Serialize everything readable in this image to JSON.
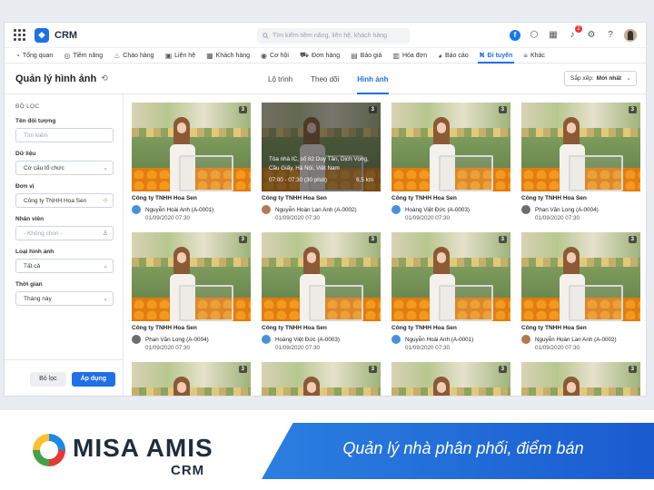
{
  "header": {
    "app_name": "CRM",
    "search_placeholder": "Tìm kiếm tiềm năng, liên hệ, khách hàng",
    "notification_count": "2"
  },
  "nav": [
    {
      "label": "Tổng quan",
      "icon": "dashboard-icon",
      "glyph": "◔"
    },
    {
      "label": "Tiềm năng",
      "icon": "lead-icon",
      "glyph": "◎"
    },
    {
      "label": "Chào hàng",
      "icon": "handshake-icon",
      "glyph": "♨"
    },
    {
      "label": "Liên hệ",
      "icon": "contact-icon",
      "glyph": "▣"
    },
    {
      "label": "Khách hàng",
      "icon": "customer-icon",
      "glyph": "▦"
    },
    {
      "label": "Cơ hội",
      "icon": "opportunity-icon",
      "glyph": "◉"
    },
    {
      "label": "Đơn hàng",
      "icon": "cart-icon",
      "glyph": "⛟"
    },
    {
      "label": "Báo giá",
      "icon": "quote-icon",
      "glyph": "▤"
    },
    {
      "label": "Hóa đơn",
      "icon": "invoice-icon",
      "glyph": "▥"
    },
    {
      "label": "Báo cáo",
      "icon": "report-icon",
      "glyph": "◕"
    },
    {
      "label": "Đi tuyến",
      "icon": "route-icon",
      "glyph": "⛕"
    },
    {
      "label": "Khác",
      "icon": "more-icon",
      "glyph": "≡"
    }
  ],
  "nav_active_index": 10,
  "subheader": {
    "title": "Quản lý hình ảnh",
    "tabs": [
      "Lộ trình",
      "Theo dõi",
      "Hình ảnh"
    ],
    "active_tab": 2,
    "sort_label": "Sắp xếp:",
    "sort_value": "Mới nhất"
  },
  "filter": {
    "title": "BỘ LỌC",
    "object_name_label": "Tên đối tượng",
    "object_name_placeholder": "Tìm kiếm",
    "data_label": "Dữ liệu",
    "data_value": "Cơ cấu tổ chức",
    "unit_label": "Đơn vị",
    "unit_value": "Công ty TNHH Hoa Sen",
    "employee_label": "Nhân viên",
    "employee_placeholder": "- Không chọn -",
    "image_type_label": "Loại hình ảnh",
    "image_type_value": "Tất cả",
    "time_label": "Thời gian",
    "time_value": "Tháng này",
    "reset_label": "Bỏ lọc",
    "apply_label": "Áp dụng"
  },
  "cards": [
    {
      "company": "Công ty TNHH Hoa Sen",
      "employee": "Nguyễn Hoài Anh (A-0001)",
      "datetime": "01/09/2020 07:30",
      "count": "3",
      "avatar_color": "#4a90d9"
    },
    {
      "company": "Công ty TNHH Hoa Sen",
      "employee": "Nguyễn Hoàn Lan Anh (A-0002)",
      "datetime": "01/09/2020 07:30",
      "count": "3",
      "avatar_color": "#b07a50",
      "overlay": {
        "address": "Tòa nhà IC, số 82 Duy Tân, Dịch Vọng, Cầu Giấy, Hà Nội, Việt Nam",
        "time": "07:00 - 07:30 (30 phút)",
        "distance": "6,5 km"
      }
    },
    {
      "company": "Công ty TNHH Hoa Sen",
      "employee": "Hoàng Việt Đức (A-0003)",
      "datetime": "01/09/2020 07:30",
      "count": "3",
      "avatar_color": "#4a90d9"
    },
    {
      "company": "Công ty TNHH Hoa Sen",
      "employee": "Phan Văn Long (A-0004)",
      "datetime": "01/09/2020 07:30",
      "count": "3",
      "avatar_color": "#6d6d6d"
    },
    {
      "company": "Công ty TNHH Hoa Sen",
      "employee": "Phan Văn Long (A-0004)",
      "datetime": "01/09/2020 07:30",
      "count": "3",
      "avatar_color": "#6d6d6d"
    },
    {
      "company": "Công ty TNHH Hoa Sen",
      "employee": "Hoàng Việt Đức (A-0003)",
      "datetime": "01/09/2020 07:30",
      "count": "3",
      "avatar_color": "#4a90d9"
    },
    {
      "company": "Công ty TNHH Hoa Sen",
      "employee": "Nguyễn Hoài Anh (A-0001)",
      "datetime": "01/09/2020 07:30",
      "count": "3",
      "avatar_color": "#4a90d9"
    },
    {
      "company": "Công ty TNHH Hoa Sen",
      "employee": "Nguyễn Hoàn Lan Anh (A-0002)",
      "datetime": "01/09/2020 07:30",
      "count": "3",
      "avatar_color": "#b07a50"
    },
    {
      "count": "3"
    },
    {
      "count": "3"
    },
    {
      "count": "3"
    },
    {
      "count": "3"
    }
  ],
  "banner": {
    "brand": "MISA AMIS",
    "brand_sub": "CRM",
    "slogan": "Quản lý nhà phân phối, điểm bán"
  },
  "colors": {
    "accent": "#1f6fe5",
    "badge": "#e53935"
  }
}
